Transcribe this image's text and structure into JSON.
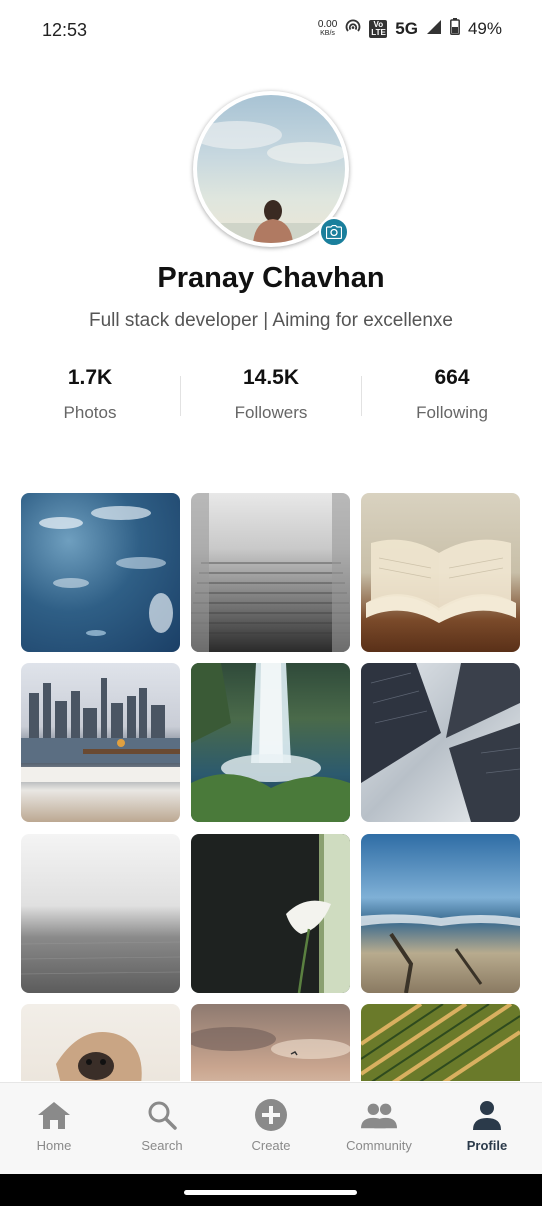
{
  "status_bar": {
    "time": "12:53",
    "net_speed_value": "0.00",
    "net_speed_unit": "KB/s",
    "volte_label": "Vo LTE",
    "network_type": "5G",
    "battery": "49%"
  },
  "profile": {
    "name": "Pranay Chavhan",
    "bio": "Full stack developer | Aiming for excellenxe",
    "avatar_icon": "camera-icon"
  },
  "stats": [
    {
      "value": "1.7K",
      "label": "Photos"
    },
    {
      "value": "14.5K",
      "label": "Followers"
    },
    {
      "value": "664",
      "label": "Following"
    }
  ],
  "photos": [
    {
      "subject": "underwater-fish"
    },
    {
      "subject": "misty-stairs"
    },
    {
      "subject": "open-book"
    },
    {
      "subject": "city-skyline-bench"
    },
    {
      "subject": "waterfall"
    },
    {
      "subject": "skyscrapers-looking-up"
    },
    {
      "subject": "foggy-sea"
    },
    {
      "subject": "calla-lily"
    },
    {
      "subject": "beach-shore"
    },
    {
      "subject": "pug-blanket"
    },
    {
      "subject": "cloudy-sky"
    },
    {
      "subject": "crop-field"
    }
  ],
  "bottom_nav": [
    {
      "label": "Home",
      "icon": "home-icon",
      "active": false
    },
    {
      "label": "Search",
      "icon": "search-icon",
      "active": false
    },
    {
      "label": "Create",
      "icon": "add-circle-icon",
      "active": false
    },
    {
      "label": "Community",
      "icon": "people-icon",
      "active": false
    },
    {
      "label": "Profile",
      "icon": "person-icon",
      "active": true
    }
  ],
  "colors": {
    "accent": "#1a7f9c",
    "active_nav": "#2b3a4a",
    "inactive_nav": "#8a8a8a"
  }
}
